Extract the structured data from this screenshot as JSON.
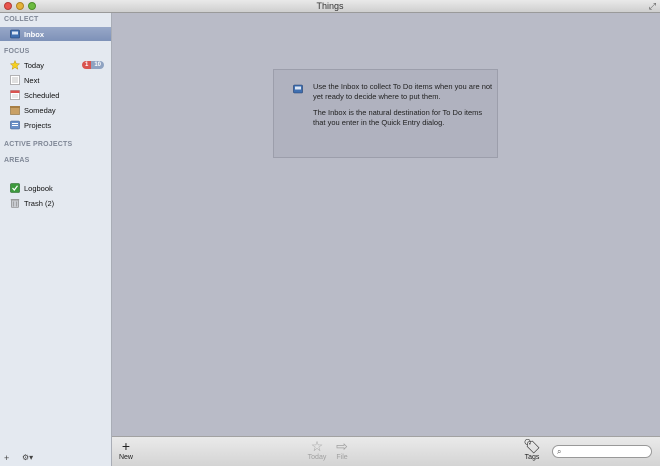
{
  "window": {
    "title": "Things"
  },
  "sidebar": {
    "sections": {
      "collect": "COLLECT",
      "focus": "FOCUS",
      "active_projects": "ACTIVE PROJECTS",
      "areas": "AREAS"
    },
    "inbox": {
      "label": "Inbox"
    },
    "focus_items": [
      {
        "label": "Today",
        "icon": "star-icon",
        "badge_due": "1",
        "badge_count": "10"
      },
      {
        "label": "Next",
        "icon": "next-list-icon"
      },
      {
        "label": "Scheduled",
        "icon": "calendar-icon"
      },
      {
        "label": "Someday",
        "icon": "box-icon"
      },
      {
        "label": "Projects",
        "icon": "projects-icon"
      }
    ],
    "bottom_items": [
      {
        "label": "Logbook",
        "icon": "logbook-icon"
      },
      {
        "label": "Trash (2)",
        "icon": "trash-icon"
      }
    ],
    "footer": {
      "add": "+",
      "gear": "⚙▾"
    }
  },
  "main": {
    "info_para1": "Use the Inbox to collect To Do items when you are not yet ready to decide where to put them.",
    "info_para2": "The Inbox is the natural destination for To Do items that you enter in the Quick Entry dialog."
  },
  "toolbar": {
    "new_label": "New",
    "today_label": "Today",
    "file_label": "File",
    "tags_label": "Tags",
    "search_placeholder": ""
  },
  "colors": {
    "selection": "#8797bd",
    "badge_red": "#d9534f",
    "badge_blue": "#8fa3c2",
    "main_bg": "#b9bbc7"
  }
}
